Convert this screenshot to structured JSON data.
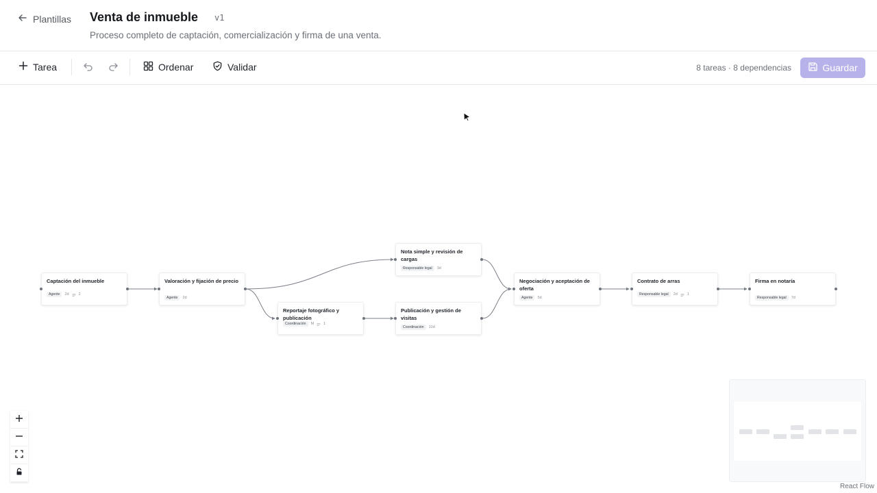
{
  "header": {
    "back_label": "Plantillas",
    "title": "Venta de inmueble",
    "version": "v1",
    "description": "Proceso completo de captación, comercialización y firma de una venta."
  },
  "toolbar": {
    "add_task_label": "Tarea",
    "order_label": "Ordenar",
    "validate_label": "Validar",
    "stats": "8 tareas · 8 dependencias",
    "save_label": "Guardar"
  },
  "nodes": [
    {
      "title": "Captación del inmueble",
      "role": "Agente",
      "duration": "2d",
      "deps": "2"
    },
    {
      "title": "Valoración y fijación de precio",
      "role": "Agente",
      "duration": "2d",
      "deps": ""
    },
    {
      "title": "Nota simple y revisión de cargas",
      "role": "Responsable legal",
      "duration": "3d",
      "deps": ""
    },
    {
      "title": "Reportaje fotográfico y publicación",
      "role": "Coordinación",
      "duration": "M",
      "deps": "1"
    },
    {
      "title": "Publicación y gestión de visitas",
      "role": "Coordinación",
      "duration": "10d",
      "deps": ""
    },
    {
      "title": "Negociación y aceptación de oferta",
      "role": "Agente",
      "duration": "5d",
      "deps": ""
    },
    {
      "title": "Contrato de arras",
      "role": "Responsable legal",
      "duration": "2d",
      "deps": "1"
    },
    {
      "title": "Firma en notaría",
      "role": "Responsable legal",
      "duration": "7d",
      "deps": ""
    }
  ],
  "attribution": "React Flow",
  "colors": {
    "accent_disabled": "#b7b3ea",
    "edge": "#7a7f87"
  }
}
